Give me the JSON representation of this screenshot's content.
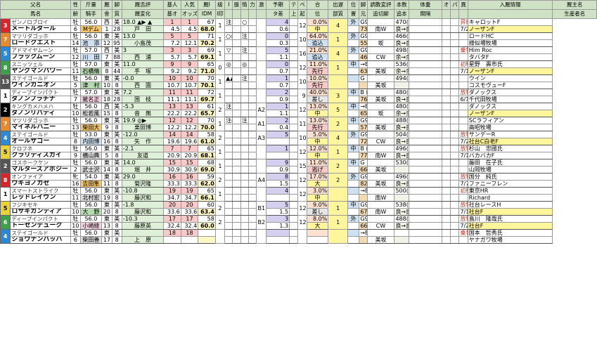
{
  "headers": {
    "top": [
      "父名",
      "性",
      "斤量",
      "厩",
      "脚",
      "厩舌評",
      "基人",
      "人気",
      "厩I",
      "級",
      "I",
      "脈",
      "情",
      "力",
      "激",
      "予期",
      "テ",
      "ベ",
      "合",
      "出遅",
      "位",
      "脚",
      "調教変評",
      "本数",
      "体重",
      "オ",
      "パ",
      "異",
      "入厩情報",
      "厩主名"
    ],
    "bottom": [
      "馬名",
      "齢",
      "騎手",
      "舎",
      "質",
      "厩変化",
      "基オ",
      "オッズ",
      "IDM",
      "I印",
      "",
      "",
      "",
      "",
      "",
      "タ差",
      "上",
      "起",
      "位",
      "部質",
      "置",
      "元",
      "追切脚",
      "追本",
      "間隔",
      "",
      "",
      "",
      "",
      "生産者名"
    ]
  },
  "horses": [
    {
      "no": "3",
      "fc": "#d9262c",
      "sire": "ゼンノロブロイ",
      "name": "メートルダール",
      "sex": "牡",
      "age": "6",
      "wt": "56.0",
      "jockey": "Mデム",
      "jbg": "#f5c56b",
      "st": "西",
      "jk": "1",
      "leg": "美",
      "l2": "28",
      "tn": "18.0 ▲▶ ▲",
      "tn2": "戸　田",
      "p1": "1",
      "p2": "1",
      "o1": "4.5",
      "o2": "4.5",
      "idm": "67",
      "idm2": "68.0",
      "g": "1",
      "m": "注",
      "m2": "○",
      "f1": "",
      "yo": "4",
      "yo2": "0.6",
      "te": "12",
      "be": "0.0%",
      "po": "中",
      "ppc": "#fff59d",
      "k": "4",
      "kb": "外",
      "kb2": "73(77)",
      "cho": "G9回 ⊠",
      "hon": "南W",
      "hon2": "3",
      "tai": "470(",
      "tai2": "良→良",
      "ex": "昇級　2-0-2-2",
      "ex2": "7/22ノーザンF天栄（福島）",
      "ow": "キャロットF",
      "ow2": "ノーザンF"
    },
    {
      "no": "7",
      "fc": "#e58a2e",
      "sire": "マツリダゴッホ",
      "name": "ロードクエスト",
      "sex": "牡",
      "age": "14",
      "wt": "56.0",
      "jockey": "池　添",
      "jbg": "#cfe2f3",
      "st": "東",
      "jk": "12",
      "leg": "美",
      "l2": "95",
      "tn": "13.0",
      "tn2": "小島茂",
      "p1": "5",
      "p2": "5",
      "o1": "7.2",
      "o2": "12.1",
      "idm": "71",
      "idm2": "70.2",
      "g": "1",
      "m": "○○",
      "m2": "注",
      "f1": "",
      "yo": "0",
      "yo2": "0.3",
      "te": "10",
      "be": "64.0%",
      "po": "追込",
      "ppc": "#cfe2f3",
      "k": "1",
      "kb": "外",
      "kb2": "55(72)",
      "cho": "G9回 ⊠",
      "hon": "坂",
      "hon2": "4",
      "tai": "466(",
      "tai2": "良→良",
      "ex": "",
      "ex2": "",
      "ow": "ロードHC",
      "ow2": "様似場牧場"
    },
    {
      "no": "5",
      "fc": "#2a8ad6",
      "sire": "アドマイヤムーン",
      "name": "ブラックムーン",
      "sex": "牡",
      "age": "12",
      "wt": "57.0",
      "jockey": "川　田",
      "jbg": "#cfe2f3",
      "st": "西",
      "jk": "7",
      "leg": "美",
      "l2": "88",
      "tn": "3",
      "tn2": "西　浦",
      "p1": "3",
      "p2": "3",
      "o1": "5.7",
      "o2": "5.7",
      "idm": "69",
      "idm2": "69.1",
      "g": "1",
      "m": "▽",
      "m2": "注",
      "f1": "",
      "yo": "5",
      "yo2": "1.1",
      "te": "16",
      "be": "21.0%",
      "po": "追込",
      "ppc": "#cfe2f3",
      "k": "4",
      "kb": "外",
      "kb2": "46(64)",
      "cho": "G9回 ⊠",
      "hon": "CW",
      "hon2": "2",
      "tai": "498(",
      "tai2": "余→余",
      "ex": "乗替",
      "ex2": "",
      "ow": "Him Roc",
      "ow2": "タバタF"
    },
    {
      "no": "8",
      "fc": "#3ea04a",
      "sire": "スニッツェル",
      "name": "ヤングマンパワー",
      "sex": "牡",
      "age": "11",
      "wt": "57.0",
      "jockey": "石橋脩",
      "jbg": "#b6dbb0",
      "st": "東",
      "jk": "8",
      "leg": "美",
      "l2": "44",
      "tn": "11.0",
      "tn2": "手　塚",
      "p1": "9",
      "p2": "9",
      "o1": "9.2",
      "o2": "9.2",
      "idm": "65",
      "idm2": "71.0",
      "g": "0",
      "m": "◎",
      "m2": "◎",
      "f1": "",
      "yo": "0",
      "yo2": "0.7",
      "te": "12",
      "be": "11.0%",
      "po": "先行",
      "ppc": "#f7c9c9",
      "k": "1",
      "kb": "中",
      "kb2": "63(63)",
      "cho": "→B",
      "hon": "美坂",
      "hon2": "4",
      "tai": "536(",
      "tai2": "余→余",
      "ex": "初騎乗　4-0-2-3",
      "ex2": "7/19ノーザンF天栄（福島）",
      "ow": "星野　壽市氏",
      "ow2": "ノーザンF"
    },
    {
      "no": "13",
      "fc": "#555",
      "sire": "ステイゴールド",
      "name": "ウインガニオン",
      "sex": "牡",
      "age": "5",
      "wt": "56.0",
      "jockey": "津　村",
      "jbg": "#b6dbb0",
      "st": "東",
      "jk": "10",
      "leg": "美",
      "l2": "8",
      "tn": "-0.0",
      "tn2": "西　園",
      "p1": "10",
      "p2": "10",
      "o1": "10.7",
      "o2": "10.7",
      "idm": "70",
      "idm2": "70.1",
      "g": "1",
      "m": "▲▲",
      "m2": "注",
      "f1": "",
      "yo": "1",
      "yo2": "0.7",
      "te": "10",
      "be": "10.0%",
      "po": "先行",
      "ppc": "#f7c9c9",
      "k": "",
      "kb": "",
      "kb2": "",
      "cho": "G ⊠",
      "hon": "美坂",
      "hon2": "",
      "tai": "494(",
      "tai2": "",
      "ex": "",
      "ex2": "",
      "ow": "ウイン",
      "ow2": "コスモヴューF"
    },
    {
      "no": "1",
      "fc": "#fff",
      "sire": "ディープインパクト",
      "name": "ダノンプラチナ",
      "sex": "牡",
      "age": "7",
      "wt": "57.0",
      "jockey": "蛯名正",
      "jbg": "#f3d0e0",
      "st": "東",
      "jk": "18",
      "leg": "美",
      "l2": "28",
      "tn": "7.2",
      "tn2": "国　枝",
      "p1": "11",
      "p2": "11",
      "o1": "11.1",
      "o2": "11.1",
      "idm": "72",
      "idm2": "69.7",
      "g": "1",
      "m": "",
      "m2": "",
      "f1": "",
      "yo": "2",
      "yo2": "0.9",
      "te": "9",
      "be": "40.0%",
      "po": "差し",
      "ppc": "#e6e6e6",
      "k": "3",
      "kb": "中",
      "kb2": "76(66)",
      "cho": "B ⊠",
      "hon": "美坂",
      "hon2": "4",
      "tai": "480(",
      "tai2": "良→良",
      "ex": "放牧(不安)　2-1-2-1",
      "ex2": "6/17千代田牧場（千葉）",
      "ow": "ダノックス",
      "ow2": "千代田牧場"
    },
    {
      "no": "2",
      "fc": "#000",
      "sire": "キングカメハメハ",
      "name": "ダノンリバティ",
      "sex": "牡",
      "age": "10",
      "wt": "56.0",
      "jockey": "松若風",
      "jbg": "#ddd",
      "st": "西",
      "jk": "15",
      "leg": "美",
      "l2": "8",
      "tn": "-5.3",
      "tn2": "音　無",
      "p1": "13",
      "p2": "13",
      "o1": "22.2",
      "o2": "22.2",
      "idm": "61",
      "idm2": "65.7",
      "g": "2",
      "m": "注",
      "m2": "",
      "f1": "A2",
      "yo": "1",
      "yo2": "1.1",
      "te": "12",
      "be": "13.0%",
      "po": "中",
      "ppc": "#fff59d",
      "k": "5",
      "kb": "中",
      "kb2": "65(67)",
      "cho": "→B",
      "hon": "坂",
      "hon2": "2",
      "tai": "480(",
      "tai2": "余→余",
      "ex": "",
      "ex2": "",
      "ow": "ダノックス",
      "ow2": "ノーザンF"
    },
    {
      "no": "7",
      "fc": "#e58a2e",
      "sire": "マツリダゴッホ",
      "name": "マイネルハニー",
      "sex": "牡",
      "age": "13",
      "wt": "56.0",
      "jockey": "柴田大",
      "jbg": "#f5c56b",
      "st": "東",
      "jk": "9",
      "leg": "美",
      "l2": "8",
      "tn": "19.9 ◎▶",
      "tn2": "栗田博",
      "p1": "12",
      "p2": "12",
      "o1": "12.2",
      "o2": "12.2",
      "idm": "70",
      "idm2": "70.0",
      "g": "1",
      "m": "注○",
      "m2": "注",
      "f1": "A1",
      "yo": "2",
      "yo2": "0.4",
      "te": "11",
      "be": "13.0%",
      "po": "先行",
      "ppc": "#f7c9c9",
      "k": "2",
      "kb": "中",
      "kb2": "57(69)",
      "cho": "G9回 ⊠",
      "hon": "美坂",
      "hon2": "4",
      "tai": "488(",
      "tai2": "良→良",
      "ex": "",
      "ex2": "",
      "ow": "SCラフィアン",
      "ow2": "高昭牧場"
    },
    {
      "no": "4",
      "fc": "#2a8ad6",
      "sire": "ステイゴールド",
      "name": "オールザゴー",
      "sex": "牡",
      "age": "8",
      "wt": "53.0",
      "jockey": "内田博",
      "jbg": "#cfe2f3",
      "st": "東",
      "jk": "16",
      "leg": "美",
      "l2": "8",
      "tn": "-12.0",
      "tn2": "矢　作",
      "p1": "14",
      "p2": "14",
      "o1": "19.6",
      "o2": "19.6",
      "idm": "58",
      "idm2": "61.0",
      "g": "2",
      "m": "",
      "m2": "",
      "f1": "A3",
      "yo": "5",
      "yo2": "",
      "te": "10",
      "be": "5.0%",
      "po": "中",
      "ppc": "#fff59d",
      "k": "4",
      "kb": "外",
      "kb2": "72(54)",
      "cho": "G9回",
      "hon": "CW",
      "hon2": "13",
      "tai": "504(",
      "tai2": "良→良",
      "ex": "放牧　0-1-0-3",
      "ex2": "7/26ノーザンFしがらき（滋賀）",
      "ow": "サンデーR",
      "ow2": "社台C白老F"
    },
    {
      "no": "5",
      "fc": "#e8d23a",
      "sire": "クロフネ",
      "name": "クラリティスカイ",
      "sex": "牡",
      "age": "9",
      "wt": "56.0",
      "jockey": "横山典",
      "jbg": "#ddd",
      "st": "東",
      "jk": "5",
      "leg": "美",
      "l2": "8",
      "tn": "-2.1",
      "tn2": "友道",
      "p1": "7",
      "p2": "7",
      "o1": "20.9",
      "o2": "20.9",
      "idm": "65",
      "idm2": "68.1",
      "g": "1",
      "m": "",
      "m2": "",
      "f1": "",
      "yo": "1",
      "yo2": "",
      "te": "12",
      "be": "12.0%",
      "po": "中",
      "ppc": "#fff59d",
      "k": "1",
      "kb": "中",
      "kb2": "77(81)",
      "cho": "B ⊠",
      "hon": "南W",
      "hon2": "4",
      "tai": "496(",
      "tai2": "良→良",
      "ex": "放牧　1-0-0-2",
      "ex2": "7/13吉澤S－ＥＡＳＴ（茨城）",
      "ow": "杉山　忠國氏",
      "ow2": "バカバカF"
    },
    {
      "no": "2",
      "fc": "#555",
      "sire": "ゴスホークケン",
      "name": "マルターズアポジー",
      "sex": "牡",
      "age": "2",
      "wt": "56.0",
      "jockey": "武士沢",
      "jbg": "#ddd",
      "st": "東",
      "jk": "14",
      "leg": "美",
      "l2": "8",
      "tn": "14.0",
      "tn2": "堀　井",
      "p1": "15",
      "p2": "15",
      "o1": "30.9",
      "o2": "30.9",
      "idm": "68",
      "idm2": "69.0",
      "g": "1",
      "m": "",
      "m2": "",
      "f1": "",
      "yo": "9",
      "yo2": "0.9",
      "te": "15",
      "be": "11.0%",
      "po": "逃げ",
      "ppc": "#f7c9c9",
      "k": "2",
      "kb": "中",
      "kb2": "66(66)",
      "cho": "G ⊠",
      "hon": "美坂",
      "hon2": "",
      "tai": "530(",
      "tai2": "",
      "ex": "",
      "ex2": "",
      "ow": "藤田　在子氏",
      "ow2": "山岡牧場"
    },
    {
      "no": "8",
      "fc": "#d9262c",
      "sire": "オンファイア",
      "name": "ウキヨノカゼ",
      "sex": "牝",
      "age": "16",
      "wt": "54.0",
      "jockey": "吉田隼",
      "jbg": "#f5c56b",
      "st": "東",
      "jk": "11",
      "leg": "美",
      "l2": "8",
      "tn": "29.0",
      "tn2": "菊沢隆",
      "p1": "16",
      "p2": "16",
      "o1": "33.3",
      "o2": "33.3",
      "idm": "59",
      "idm2": "62.0",
      "g": "2",
      "m": "",
      "m2": "",
      "f1": "A4",
      "yo": "8",
      "yo2": "1.5",
      "te": "12",
      "be": "17.0%",
      "po": "大",
      "ppc": "#fff59d",
      "k": "2",
      "kb": "外",
      "kb2": "82(60)",
      "cho": "G9回",
      "hon": "美坂",
      "hon2": "13",
      "tai": "496(",
      "tai2": "良→良",
      "ex": "放牧　2-0-0-5",
      "ex2": "7/7ＫＳトレーニングＣ（茨城）",
      "ow": "国分　純氏",
      "ow2": "ファニーフレン"
    },
    {
      "no": "1",
      "fc": "#fff",
      "sire": "スマートストライク",
      "name": "レッドレイヴン",
      "sex": "牡",
      "age": "11",
      "wt": "56.0",
      "jockey": "北村宏",
      "jbg": "#ddd",
      "st": "東",
      "jk": "19",
      "leg": "美",
      "l2": "8",
      "tn": "-10.8",
      "tn2": "藤沢和",
      "p1": "19",
      "p2": "19",
      "o1": "34.7",
      "o2": "34.7",
      "idm": "65",
      "idm2": "66.1",
      "g": "1",
      "m": "",
      "m2": "",
      "f1": "",
      "yo": "4",
      "yo2": "",
      "te": "12",
      "be": "3.0%",
      "po": "中",
      "ppc": "#fff59d",
      "k": "",
      "kb": "",
      "kb2": "",
      "cho": "→B",
      "hon": "南W",
      "hon2": "",
      "tai": "500(",
      "tai2": "",
      "ex": "初騎乗",
      "ex2": "",
      "ow": "東京HR",
      "ow2": "Richard"
    },
    {
      "no": "5",
      "fc": "#e8d23a",
      "sire": "フジキセキ",
      "name": "ロサギガンティア",
      "sex": "牡",
      "age": "10",
      "wt": "56.0",
      "jockey": "大　野",
      "jbg": "#b6dbb0",
      "st": "東",
      "jk": "20",
      "leg": "美",
      "l2": "8",
      "tn": "-1.8",
      "tn2": "藤沢和",
      "p1": "20",
      "p2": "20",
      "o1": "33.6",
      "o2": "33.6",
      "idm": "60",
      "idm2": "63.4",
      "g": "2",
      "m": "",
      "m2": "",
      "f1": "B1",
      "yo": "5",
      "yo2": "1.5",
      "te": "12",
      "be": "9.0%",
      "po": "差し",
      "ppc": "#e6e6e6",
      "k": "1",
      "kb": "中",
      "kb2": "67(68)",
      "cho": "G9回",
      "hon": "南W",
      "hon2": "14",
      "tai": "538(",
      "tai2": "良→良",
      "ex": "放牧初騎乗　4-0-1-4",
      "ex2": "7/13社台F山元ＴＣ（宮城）",
      "ow": "社台レースH",
      "ow2": "社台F"
    },
    {
      "no": "6",
      "fc": "#3ea04a",
      "sire": "ディープインパクト",
      "name": "トーセンデューク",
      "sex": "牡",
      "age": "10",
      "wt": "56.0",
      "jockey": "小崎綾",
      "jbg": "#f3d0e0",
      "st": "東",
      "jk": "13",
      "leg": "美",
      "l2": "8",
      "tn": "-10.3",
      "tn2": "藤原英",
      "p1": "17",
      "p2": "17",
      "o1": "32.4",
      "o2": "32.4",
      "idm": "58",
      "idm2": "60.0",
      "g": "2",
      "m": "",
      "m2": "",
      "f1": "B2",
      "yo": "3",
      "yo2": "1.3",
      "te": "12",
      "be": "8.0%",
      "po": "大",
      "ppc": "#fff59d",
      "k": "1",
      "kb": "外",
      "kb2": "66(62)",
      "cho": "G9回",
      "hon": "CW",
      "hon2": "14",
      "tai": "488(",
      "tai2": "良→良",
      "ex": "放牧　1-2-0-3",
      "ex2": "7/26グリーンウッド（滋賀）",
      "ow": "島川　隆哉氏",
      "ow2": "社台F"
    },
    {
      "no": "4",
      "fc": "#2a8ad6",
      "sire": "ステイゴールド",
      "name": "ショウナンバッハ",
      "sex": "牡",
      "age": "6",
      "wt": "56.0",
      "jockey": "柴田善",
      "jbg": "#ddd",
      "st": "東",
      "jk": "17",
      "leg": "美",
      "l2": "8",
      "tn": "",
      "tn2": "上　原",
      "p1": "18",
      "p2": "18",
      "o1": "",
      "o2": "",
      "idm": "",
      "idm2": "",
      "g": "",
      "m": "",
      "m2": "",
      "f1": "",
      "yo": "",
      "yo2": "",
      "te": "",
      "be": "",
      "po": "",
      "ppc": "#fff",
      "k": "",
      "kb": "",
      "kb2": "",
      "cho": "→B",
      "hon": "美坂",
      "hon2": "",
      "tai": "",
      "tai2": "",
      "ex": "乗替",
      "ex2": "",
      "ow": "国本　哲秀氏",
      "ow2": "ヤナガワ牧場"
    }
  ]
}
